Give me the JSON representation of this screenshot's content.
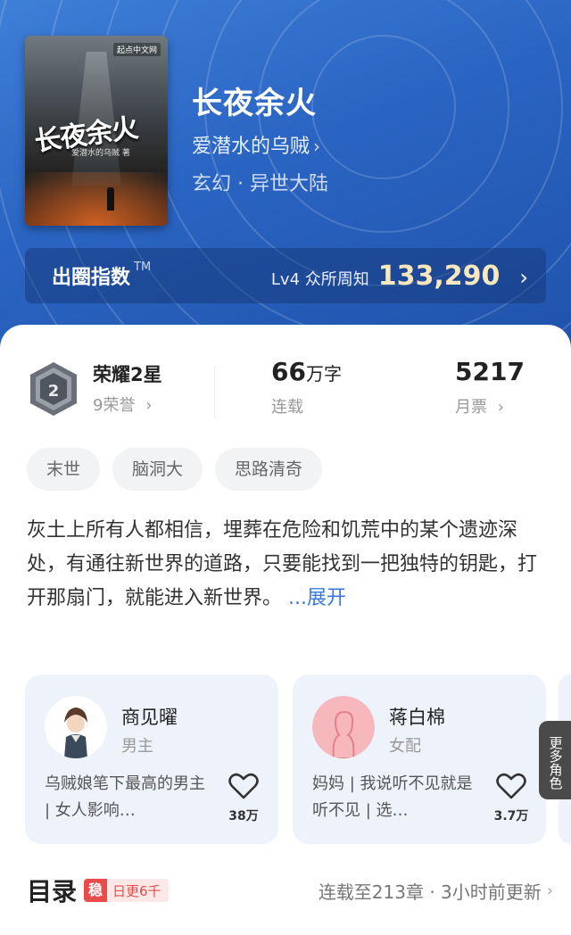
{
  "book": {
    "title": "长夜余火",
    "author": "爱潜水的乌贼",
    "author_chevron": "›",
    "genre": "玄幻 · 异世大陆",
    "cover_title": "长夜余火",
    "cover_author": "爱潜水的乌贼 著",
    "cover_publisher": "起点中文网"
  },
  "rank": {
    "label": "出圈指数",
    "tm": "TM",
    "level": "Lv4 众所周知",
    "score": "133,290",
    "chevron": "›"
  },
  "stats": {
    "honor_title": "荣耀2星",
    "honor_sub": "9荣誉",
    "honor_badge_number": "2",
    "words_value": "66",
    "words_unit": "万字",
    "words_sub": "连载",
    "votes_value": "5217",
    "votes_sub": "月票"
  },
  "tags": [
    "末世",
    "脑洞大",
    "思路清奇"
  ],
  "description": {
    "text": "灰土上所有人都相信，埋葬在危险和饥荒中的某个遗迹深处，有通往新世界的道路，只要能找到一把独特的钥匙，打开那扇门，就能进入新世界。",
    "more": " ...展开"
  },
  "roles": [
    {
      "name": "商见曜",
      "type": "男主",
      "desc": "乌贼娘笔下最高的男主 | 女人影响…",
      "likes": "38万"
    },
    {
      "name": "蒋白棉",
      "type": "女配",
      "desc": "妈妈 | 我说听不见就是听不见 | 选…",
      "likes": "3.7万"
    }
  ],
  "more_roles": "更多角色",
  "catalog": {
    "title": "目录",
    "stable_icon": "稳",
    "stable_text": "日更6千",
    "update": "连载至213章 · 3小时前更新"
  },
  "colors": {
    "header_blue": "#2a64c2",
    "score_gold": "#fbe7bd",
    "link_blue": "#3a78e0",
    "stable_red": "#e94b4b"
  }
}
